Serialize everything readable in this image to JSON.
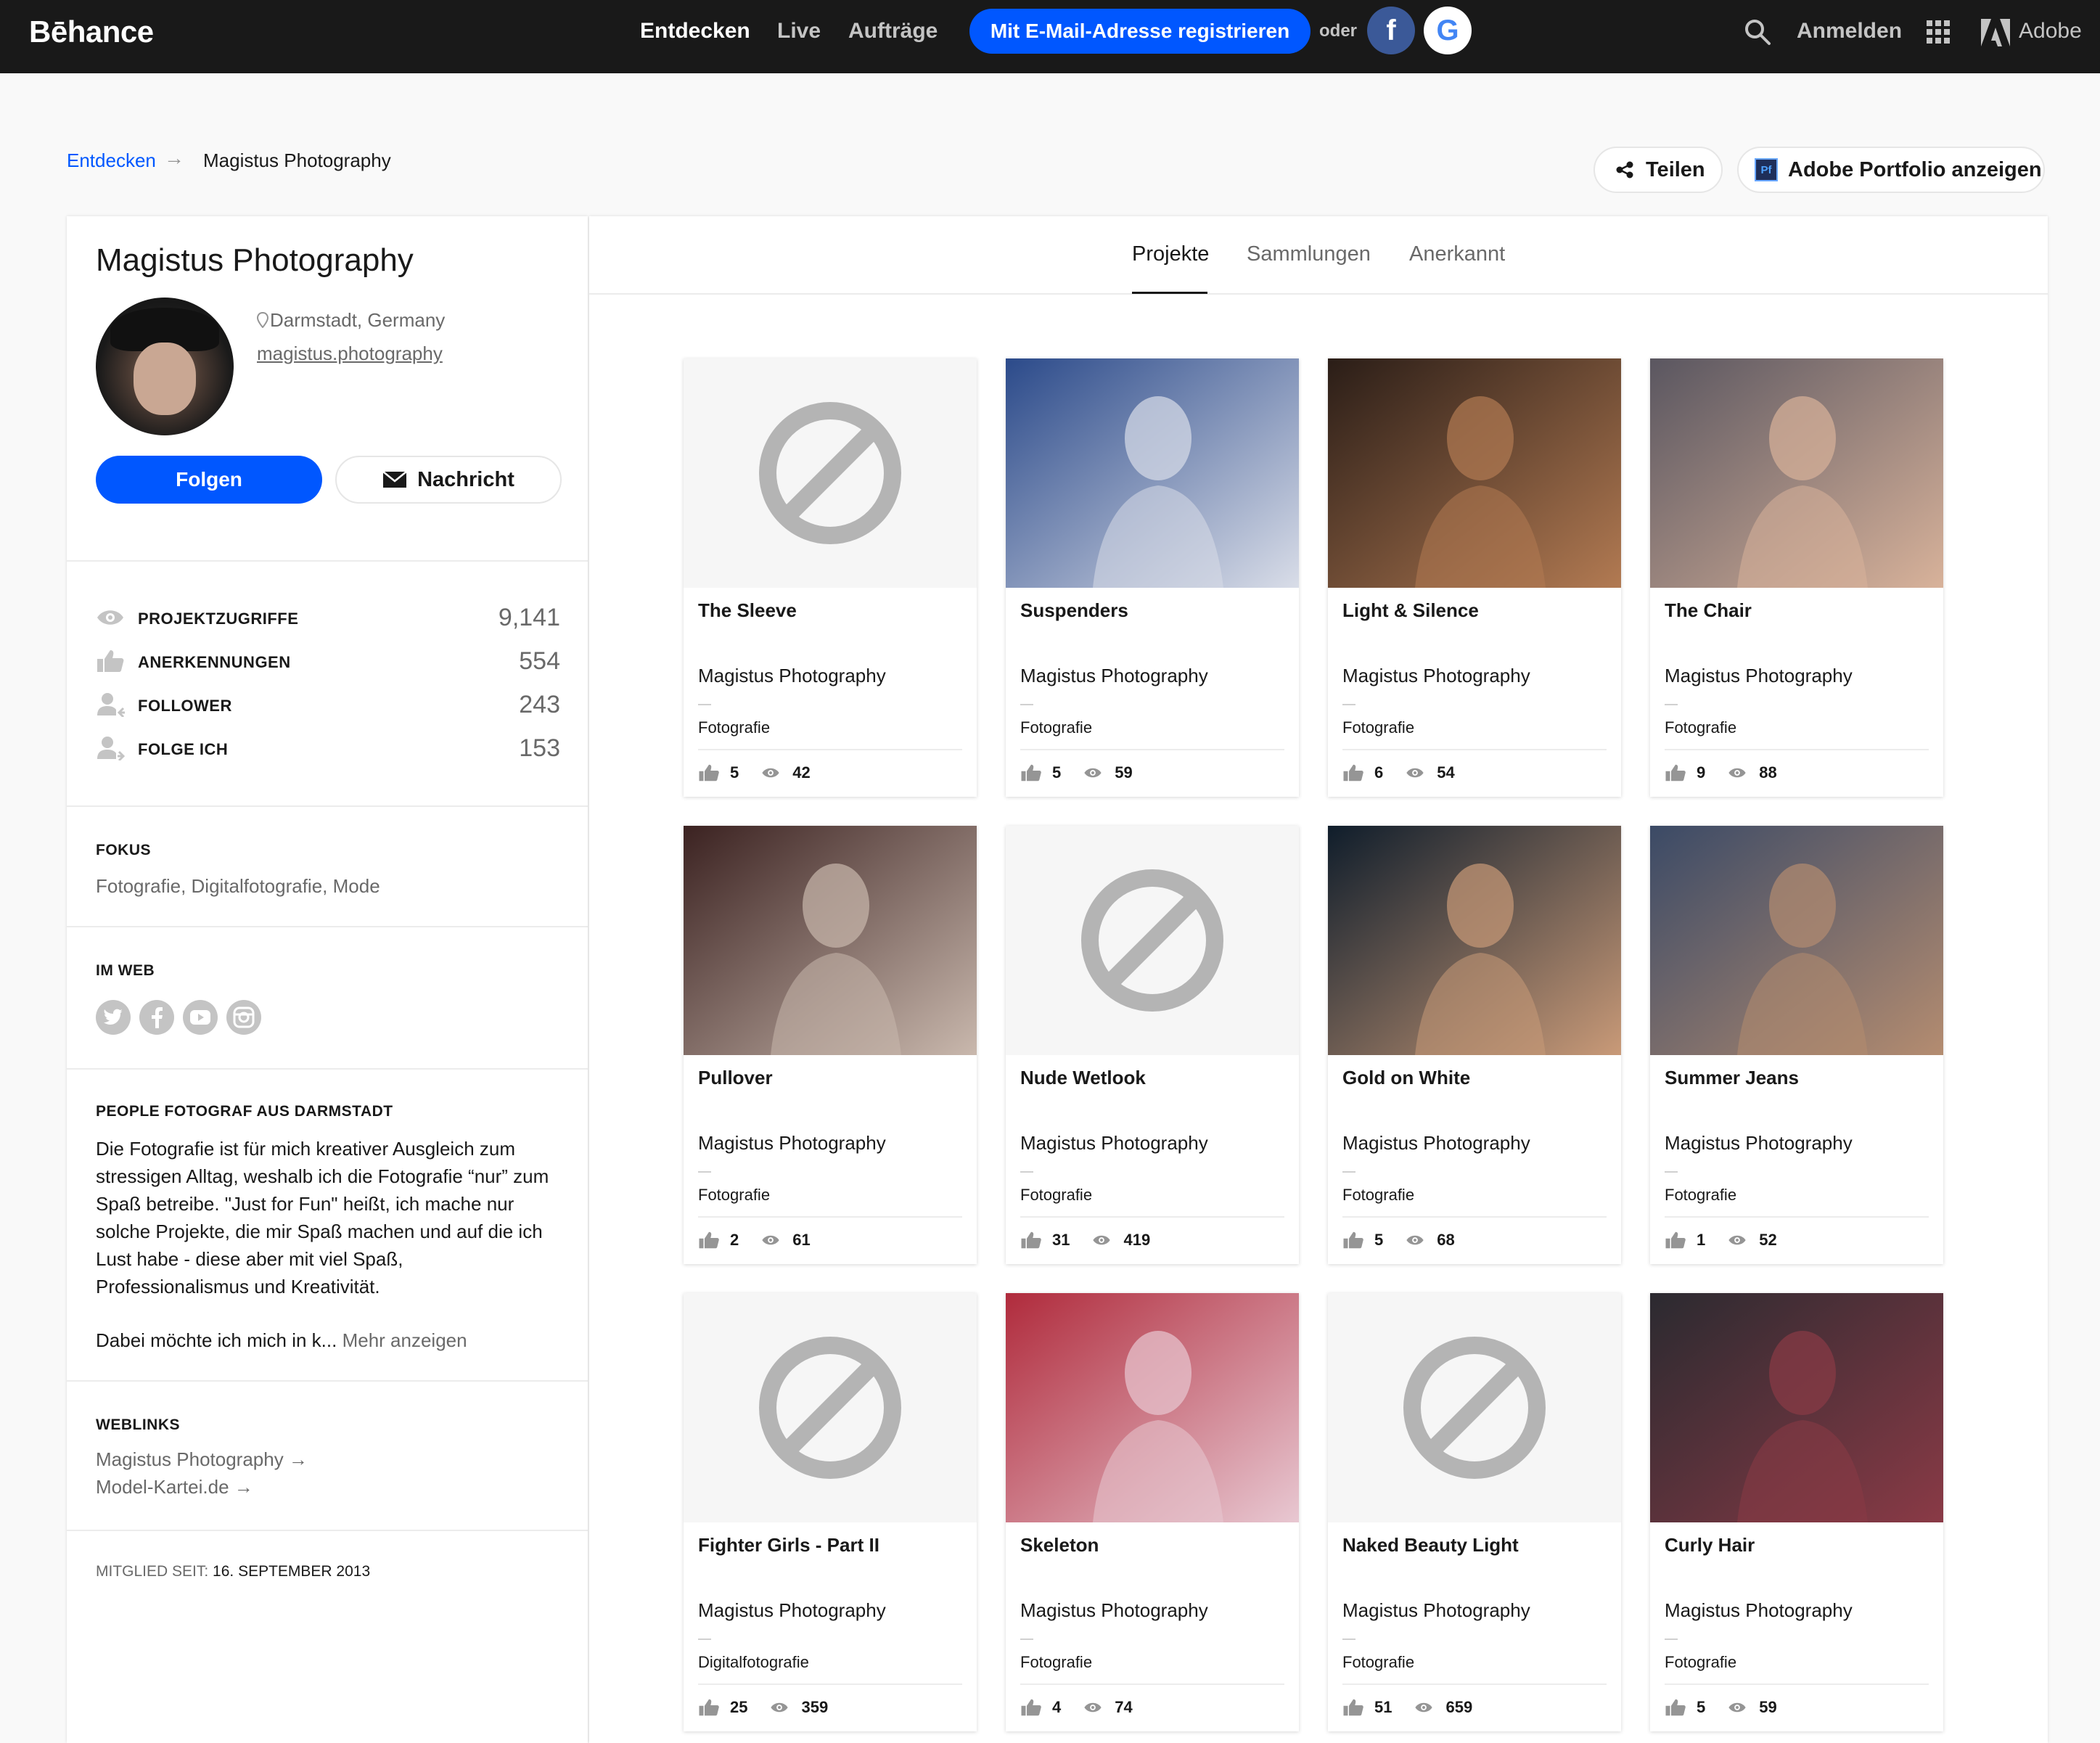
{
  "topbar": {
    "logo": "Bēhance",
    "nav": [
      "Entdecken",
      "Live",
      "Aufträge"
    ],
    "register_label": "Mit E-Mail-Adresse registrieren",
    "or_label": "oder",
    "facebook_glyph": "f",
    "google_glyph": "G",
    "login_label": "Anmelden",
    "adobe_label": "Adobe"
  },
  "breadcrumb": {
    "link": "Entdecken",
    "arrow": "→",
    "current": "Magistus Photography"
  },
  "actions": {
    "share_label": "Teilen",
    "portfolio_label": "Adobe Portfolio anzeigen",
    "portfolio_badge": "Pf"
  },
  "profile": {
    "name": "Magistus Photography",
    "location": "Darmstadt, Germany",
    "website": "magistus.photography",
    "follow_label": "Folgen",
    "message_label": "Nachricht",
    "stats": [
      {
        "label": "PROJEKTZUGRIFFE",
        "value": "9,141",
        "icon": "eye-icon"
      },
      {
        "label": "ANERKENNUNGEN",
        "value": "554",
        "icon": "thumbs-up-icon"
      },
      {
        "label": "FOLLOWER",
        "value": "243",
        "icon": "follower-icon"
      },
      {
        "label": "FOLGE ICH",
        "value": "153",
        "icon": "following-icon"
      }
    ],
    "focus_head": "FOKUS",
    "focus_text": "Fotografie, Digitalfotografie, Mode",
    "web_head": "IM WEB",
    "social": [
      "twitter-icon",
      "facebook-icon",
      "youtube-icon",
      "instagram-icon"
    ],
    "bio_head": "PEOPLE FOTOGRAF AUS DARMSTADT",
    "bio": "Die Fotografie ist für mich kreativer Ausgleich zum stressigen Alltag, weshalb ich die Fotografie “nur” zum Spaß betreibe. \"Just for Fun\" heißt, ich mache nur solche Projekte, die mir Spaß machen und auf die ich Lust habe - diese aber mit viel Spaß, Professionalismus und Kreativität.",
    "bio_more_text": "Dabei möchte ich mich in k...",
    "bio_more_link": "Mehr anzeigen",
    "weblinks_head": "WEBLINKS",
    "weblinks": [
      "Magistus Photography →",
      "Model-Kartei.de →"
    ],
    "member_label": "MITGLIED SEIT:",
    "member_date": "16. SEPTEMBER 2013"
  },
  "tabs": [
    "Projekte",
    "Sammlungen",
    "Anerkannt"
  ],
  "projects": [
    {
      "title": "The Sleeve",
      "owner": "Magistus Photography",
      "field": "Fotografie",
      "likes": "5",
      "views": "42",
      "blocked": true,
      "color_a": "#f6f6f6",
      "color_b": "#f6f6f6"
    },
    {
      "title": "Suspenders",
      "owner": "Magistus Photography",
      "field": "Fotografie",
      "likes": "5",
      "views": "59",
      "blocked": false,
      "color_a": "#2b4a8a",
      "color_b": "#d9dde8"
    },
    {
      "title": "Light & Silence",
      "owner": "Magistus Photography",
      "field": "Fotografie",
      "likes": "6",
      "views": "54",
      "blocked": false,
      "color_a": "#2a1d17",
      "color_b": "#b27a52"
    },
    {
      "title": "The Chair",
      "owner": "Magistus Photography",
      "field": "Fotografie",
      "likes": "9",
      "views": "88",
      "blocked": false,
      "color_a": "#5a5660",
      "color_b": "#d8b29a"
    },
    {
      "title": "Pullover",
      "owner": "Magistus Photography",
      "field": "Fotografie",
      "likes": "2",
      "views": "61",
      "blocked": false,
      "color_a": "#3b2221",
      "color_b": "#c9b8ad"
    },
    {
      "title": "Nude Wetlook",
      "owner": "Magistus Photography",
      "field": "Fotografie",
      "likes": "31",
      "views": "419",
      "blocked": true,
      "color_a": "#f6f6f6",
      "color_b": "#f6f6f6"
    },
    {
      "title": "Gold on White",
      "owner": "Magistus Photography",
      "field": "Fotografie",
      "likes": "5",
      "views": "68",
      "blocked": false,
      "color_a": "#0f1d2b",
      "color_b": "#c99a78"
    },
    {
      "title": "Summer Jeans",
      "owner": "Magistus Photography",
      "field": "Fotografie",
      "likes": "1",
      "views": "52",
      "blocked": false,
      "color_a": "#3b4a66",
      "color_b": "#b48c70"
    },
    {
      "title": "Fighter Girls - Part II",
      "owner": "Magistus Photography",
      "field": "Digitalfotografie",
      "likes": "25",
      "views": "359",
      "blocked": true,
      "color_a": "#f6f6f6",
      "color_b": "#f6f6f6"
    },
    {
      "title": "Skeleton",
      "owner": "Magistus Photography",
      "field": "Fotografie",
      "likes": "4",
      "views": "74",
      "blocked": false,
      "color_a": "#b02b3c",
      "color_b": "#e8c8d2"
    },
    {
      "title": "Naked Beauty Light",
      "owner": "Magistus Photography",
      "field": "Fotografie",
      "likes": "51",
      "views": "659",
      "blocked": true,
      "color_a": "#f6f6f6",
      "color_b": "#f6f6f6"
    },
    {
      "title": "Curly Hair",
      "owner": "Magistus Photography",
      "field": "Fotografie",
      "likes": "5",
      "views": "59",
      "blocked": false,
      "color_a": "#2b2a30",
      "color_b": "#8a3a46"
    }
  ]
}
